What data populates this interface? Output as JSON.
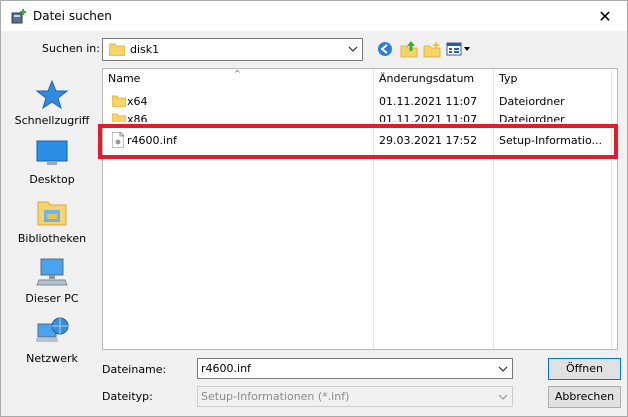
{
  "window": {
    "title": "Datei suchen"
  },
  "toolbar": {
    "look_in_label": "Suchen in:",
    "look_in_value": "disk1"
  },
  "places": [
    {
      "label": "Schnellzugriff",
      "icon": "star-icon"
    },
    {
      "label": "Desktop",
      "icon": "desktop-icon"
    },
    {
      "label": "Bibliotheken",
      "icon": "library-icon"
    },
    {
      "label": "Dieser PC",
      "icon": "computer-icon"
    },
    {
      "label": "Netzwerk",
      "icon": "network-icon"
    }
  ],
  "file_list": {
    "columns": [
      "Name",
      "Änderungsdatum",
      "Typ"
    ],
    "rows": [
      {
        "name": "x64",
        "date": "01.11.2021 11:07",
        "type": "Dateiordner",
        "icon": "folder-icon"
      },
      {
        "name": "x86",
        "date": "01.11.2021 11:07",
        "type": "Dateiordner",
        "icon": "folder-icon"
      },
      {
        "name": "r4600.inf",
        "date": "29.03.2021 17:52",
        "type": "Setup-Informatio...",
        "icon": "inf-file-icon"
      }
    ]
  },
  "footer": {
    "filename_label": "Dateiname:",
    "filename_value": "r4600.inf",
    "filetype_label": "Dateityp:",
    "filetype_value": "Setup-Informationen (*.inf)",
    "open_label": "Öffnen",
    "cancel_label": "Abbrechen"
  },
  "colors": {
    "highlight": "#e21c2a",
    "accent": "#0078d7"
  }
}
